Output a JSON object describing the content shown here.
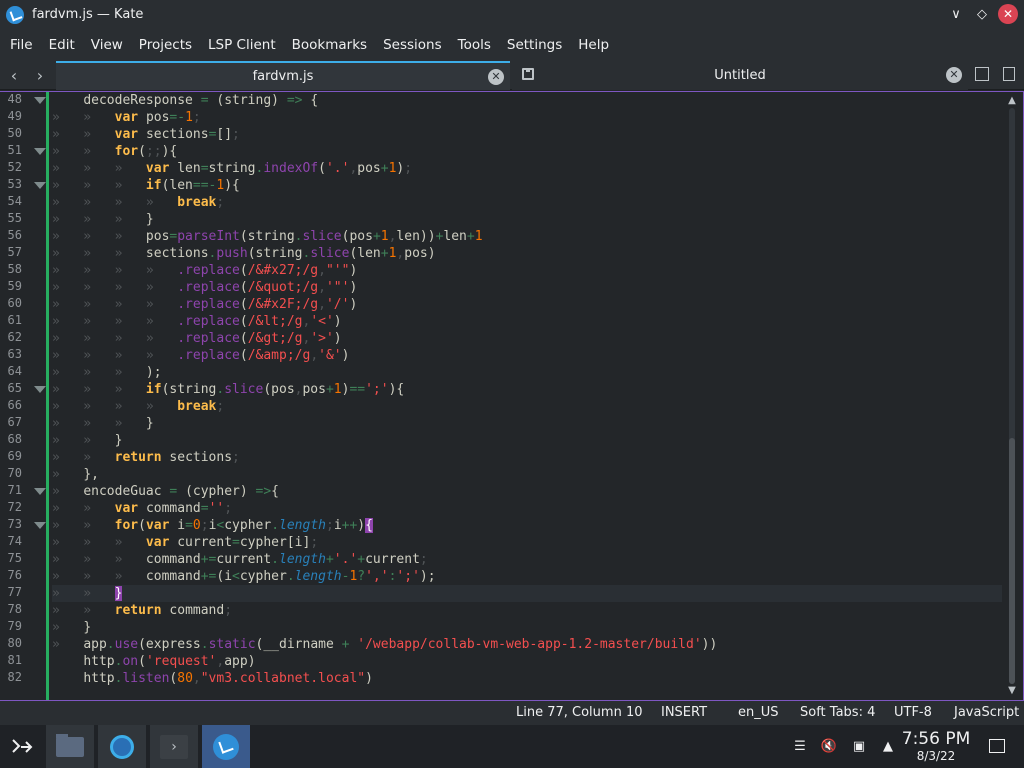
{
  "window": {
    "title": "fardvm.js — Kate"
  },
  "menu": [
    "File",
    "Edit",
    "View",
    "Projects",
    "LSP Client",
    "Bookmarks",
    "Sessions",
    "Tools",
    "Settings",
    "Help"
  ],
  "tabs": [
    {
      "label": "fardvm.js",
      "active": true
    },
    {
      "label": "Untitled",
      "active": false
    }
  ],
  "editor": {
    "current_line": 77,
    "lines": [
      {
        "n": 48,
        "fold": true,
        "tokens": [
          [
            "",
            ""
          ],
          [
            "    ",
            ""
          ],
          [
            "decodeResponse ",
            "punct"
          ],
          [
            "= ",
            "op"
          ],
          [
            "(string) ",
            "punct"
          ],
          [
            "=> ",
            "op"
          ],
          [
            "{",
            "punct"
          ]
        ]
      },
      {
        "n": 49,
        "fold": false,
        "tokens": [
          [
            "»   »   ",
            "ws"
          ],
          [
            "var ",
            "kw"
          ],
          [
            "pos",
            "punct"
          ],
          [
            "=-",
            "op"
          ],
          [
            "1",
            "num"
          ],
          [
            ";",
            "ws"
          ]
        ]
      },
      {
        "n": 50,
        "fold": false,
        "tokens": [
          [
            "»   »   ",
            "ws"
          ],
          [
            "var ",
            "kw"
          ],
          [
            "sections",
            "punct"
          ],
          [
            "=",
            "op"
          ],
          [
            "[]",
            "punct"
          ],
          [
            ";",
            "ws"
          ]
        ]
      },
      {
        "n": 51,
        "fold": true,
        "tokens": [
          [
            "»   »   ",
            "ws"
          ],
          [
            "for",
            "kw"
          ],
          [
            "(",
            "punct"
          ],
          [
            ";;",
            "ws"
          ],
          [
            "){",
            "punct"
          ]
        ]
      },
      {
        "n": 52,
        "fold": false,
        "tokens": [
          [
            "»   »   »   ",
            "ws"
          ],
          [
            "var ",
            "kw"
          ],
          [
            "len",
            "punct"
          ],
          [
            "=",
            "op"
          ],
          [
            "string",
            "punct"
          ],
          [
            ".",
            "op"
          ],
          [
            "indexOf",
            "fn"
          ],
          [
            "(",
            "punct"
          ],
          [
            "'.'",
            "str"
          ],
          [
            ",",
            "ws"
          ],
          [
            "pos",
            "punct"
          ],
          [
            "+",
            "op"
          ],
          [
            "1",
            "num"
          ],
          [
            ")",
            "punct"
          ],
          [
            ";",
            "ws"
          ]
        ]
      },
      {
        "n": 53,
        "fold": true,
        "tokens": [
          [
            "»   »   »   ",
            "ws"
          ],
          [
            "if",
            "kw"
          ],
          [
            "(len",
            "punct"
          ],
          [
            "==-",
            "op"
          ],
          [
            "1",
            "num"
          ],
          [
            "){",
            "punct"
          ]
        ]
      },
      {
        "n": 54,
        "fold": false,
        "tokens": [
          [
            "»   »   »   »   ",
            "ws"
          ],
          [
            "break",
            "kw"
          ],
          [
            ";",
            "ws"
          ]
        ]
      },
      {
        "n": 55,
        "fold": false,
        "tokens": [
          [
            "»   »   »   ",
            "ws"
          ],
          [
            "}",
            "punct"
          ]
        ]
      },
      {
        "n": 56,
        "fold": false,
        "tokens": [
          [
            "»   »   »   ",
            "ws"
          ],
          [
            "pos",
            "punct"
          ],
          [
            "=",
            "op"
          ],
          [
            "parseInt",
            "fn"
          ],
          [
            "(string",
            "punct"
          ],
          [
            ".",
            "op"
          ],
          [
            "slice",
            "fn"
          ],
          [
            "(pos",
            "punct"
          ],
          [
            "+",
            "op"
          ],
          [
            "1",
            "num"
          ],
          [
            ",",
            "ws"
          ],
          [
            "len))",
            "punct"
          ],
          [
            "+",
            "op"
          ],
          [
            "len",
            "punct"
          ],
          [
            "+",
            "op"
          ],
          [
            "1",
            "num"
          ]
        ]
      },
      {
        "n": 57,
        "fold": false,
        "tokens": [
          [
            "»   »   »   ",
            "ws"
          ],
          [
            "sections",
            "punct"
          ],
          [
            ".",
            "op"
          ],
          [
            "push",
            "fn"
          ],
          [
            "(string",
            "punct"
          ],
          [
            ".",
            "op"
          ],
          [
            "slice",
            "fn"
          ],
          [
            "(len",
            "punct"
          ],
          [
            "+",
            "op"
          ],
          [
            "1",
            "num"
          ],
          [
            ",",
            "ws"
          ],
          [
            "pos)",
            "punct"
          ]
        ]
      },
      {
        "n": 58,
        "fold": false,
        "tokens": [
          [
            "»   »   »   »   ",
            "ws"
          ],
          [
            ".replace",
            "fn"
          ],
          [
            "(",
            "punct"
          ],
          [
            "/&#x27;/g",
            "str"
          ],
          [
            ",",
            "ws"
          ],
          [
            "\"'\"",
            "str"
          ],
          [
            ")",
            "punct"
          ]
        ]
      },
      {
        "n": 59,
        "fold": false,
        "tokens": [
          [
            "»   »   »   »   ",
            "ws"
          ],
          [
            ".replace",
            "fn"
          ],
          [
            "(",
            "punct"
          ],
          [
            "/&quot;/g",
            "str"
          ],
          [
            ",",
            "ws"
          ],
          [
            "'\"'",
            "str"
          ],
          [
            ")",
            "punct"
          ]
        ]
      },
      {
        "n": 60,
        "fold": false,
        "tokens": [
          [
            "»   »   »   »   ",
            "ws"
          ],
          [
            ".replace",
            "fn"
          ],
          [
            "(",
            "punct"
          ],
          [
            "/&#x2F;/g",
            "str"
          ],
          [
            ",",
            "ws"
          ],
          [
            "'/'",
            "str"
          ],
          [
            ")",
            "punct"
          ]
        ]
      },
      {
        "n": 61,
        "fold": false,
        "tokens": [
          [
            "»   »   »   »   ",
            "ws"
          ],
          [
            ".replace",
            "fn"
          ],
          [
            "(",
            "punct"
          ],
          [
            "/&lt;/g",
            "str"
          ],
          [
            ",",
            "ws"
          ],
          [
            "'<'",
            "str"
          ],
          [
            ")",
            "punct"
          ]
        ]
      },
      {
        "n": 62,
        "fold": false,
        "tokens": [
          [
            "»   »   »   »   ",
            "ws"
          ],
          [
            ".replace",
            "fn"
          ],
          [
            "(",
            "punct"
          ],
          [
            "/&gt;/g",
            "str"
          ],
          [
            ",",
            "ws"
          ],
          [
            "'>'",
            "str"
          ],
          [
            ")",
            "punct"
          ]
        ]
      },
      {
        "n": 63,
        "fold": false,
        "tokens": [
          [
            "»   »   »   »   ",
            "ws"
          ],
          [
            ".replace",
            "fn"
          ],
          [
            "(",
            "punct"
          ],
          [
            "/&amp;/g",
            "str"
          ],
          [
            ",",
            "ws"
          ],
          [
            "'&'",
            "str"
          ],
          [
            ")",
            "punct"
          ]
        ]
      },
      {
        "n": 64,
        "fold": false,
        "tokens": [
          [
            "»   »   »   ",
            "ws"
          ],
          [
            ");",
            "punct"
          ]
        ]
      },
      {
        "n": 65,
        "fold": true,
        "tokens": [
          [
            "»   »   »   ",
            "ws"
          ],
          [
            "if",
            "kw"
          ],
          [
            "(string",
            "punct"
          ],
          [
            ".",
            "op"
          ],
          [
            "slice",
            "fn"
          ],
          [
            "(pos",
            "punct"
          ],
          [
            ",",
            "ws"
          ],
          [
            "pos",
            "punct"
          ],
          [
            "+",
            "op"
          ],
          [
            "1",
            "num"
          ],
          [
            ")",
            "punct"
          ],
          [
            "==",
            "op"
          ],
          [
            "';'",
            "str"
          ],
          [
            "){",
            "punct"
          ]
        ]
      },
      {
        "n": 66,
        "fold": false,
        "tokens": [
          [
            "»   »   »   »   ",
            "ws"
          ],
          [
            "break",
            "kw"
          ],
          [
            ";",
            "ws"
          ]
        ]
      },
      {
        "n": 67,
        "fold": false,
        "tokens": [
          [
            "»   »   »   ",
            "ws"
          ],
          [
            "}",
            "punct"
          ]
        ]
      },
      {
        "n": 68,
        "fold": false,
        "tokens": [
          [
            "»   »   ",
            "ws"
          ],
          [
            "}",
            "punct"
          ]
        ]
      },
      {
        "n": 69,
        "fold": false,
        "tokens": [
          [
            "»   »   ",
            "ws"
          ],
          [
            "return ",
            "kw"
          ],
          [
            "sections",
            "punct"
          ],
          [
            ";",
            "ws"
          ]
        ]
      },
      {
        "n": 70,
        "fold": false,
        "tokens": [
          [
            "»   ",
            "ws"
          ],
          [
            "},",
            "punct"
          ]
        ]
      },
      {
        "n": 71,
        "fold": true,
        "tokens": [
          [
            "»   ",
            "ws"
          ],
          [
            "encodeGuac ",
            "punct"
          ],
          [
            "= ",
            "op"
          ],
          [
            "(cypher) ",
            "punct"
          ],
          [
            "=>",
            "op"
          ],
          [
            "{",
            "punct"
          ]
        ]
      },
      {
        "n": 72,
        "fold": false,
        "tokens": [
          [
            "»   »   ",
            "ws"
          ],
          [
            "var ",
            "kw"
          ],
          [
            "command",
            "punct"
          ],
          [
            "=",
            "op"
          ],
          [
            "''",
            "str"
          ],
          [
            ";",
            "ws"
          ]
        ]
      },
      {
        "n": 73,
        "fold": true,
        "tokens": [
          [
            "»   »   ",
            "ws"
          ],
          [
            "for",
            "kw"
          ],
          [
            "(",
            "punct"
          ],
          [
            "var ",
            "kw"
          ],
          [
            "i",
            "punct"
          ],
          [
            "=",
            "op"
          ],
          [
            "0",
            "num"
          ],
          [
            ";",
            "ws"
          ],
          [
            "i",
            "punct"
          ],
          [
            "<",
            "op"
          ],
          [
            "cypher",
            "punct"
          ],
          [
            ".",
            "op"
          ],
          [
            "length",
            "prop"
          ],
          [
            ";",
            "ws"
          ],
          [
            "i",
            "punct"
          ],
          [
            "++",
            "op"
          ],
          [
            ")",
            "punct"
          ],
          [
            "{",
            "brkhl"
          ]
        ]
      },
      {
        "n": 74,
        "fold": false,
        "tokens": [
          [
            "»   »   »   ",
            "ws"
          ],
          [
            "var ",
            "kw"
          ],
          [
            "current",
            "punct"
          ],
          [
            "=",
            "op"
          ],
          [
            "cypher[i]",
            "punct"
          ],
          [
            ";",
            "ws"
          ]
        ]
      },
      {
        "n": 75,
        "fold": false,
        "tokens": [
          [
            "»   »   »   ",
            "ws"
          ],
          [
            "command",
            "punct"
          ],
          [
            "+=",
            "op"
          ],
          [
            "current",
            "punct"
          ],
          [
            ".",
            "op"
          ],
          [
            "length",
            "prop"
          ],
          [
            "+",
            "op"
          ],
          [
            "'.'",
            "str"
          ],
          [
            "+",
            "op"
          ],
          [
            "current",
            "punct"
          ],
          [
            ";",
            "ws"
          ]
        ]
      },
      {
        "n": 76,
        "fold": false,
        "tokens": [
          [
            "»   »   »   ",
            "ws"
          ],
          [
            "command",
            "punct"
          ],
          [
            "+=",
            "op"
          ],
          [
            "(i",
            "punct"
          ],
          [
            "<",
            "op"
          ],
          [
            "cypher",
            "punct"
          ],
          [
            ".",
            "op"
          ],
          [
            "length",
            "prop"
          ],
          [
            "-",
            "op"
          ],
          [
            "1",
            "num"
          ],
          [
            "?",
            "op"
          ],
          [
            "','",
            "str"
          ],
          [
            ":",
            "op"
          ],
          [
            "';'",
            "str"
          ],
          [
            ");",
            "punct"
          ]
        ]
      },
      {
        "n": 77,
        "fold": false,
        "tokens": [
          [
            "»   »   ",
            "ws"
          ],
          [
            "}",
            "brkhl"
          ]
        ]
      },
      {
        "n": 78,
        "fold": false,
        "tokens": [
          [
            "»   »   ",
            "ws"
          ],
          [
            "return ",
            "kw"
          ],
          [
            "command",
            "punct"
          ],
          [
            ";",
            "ws"
          ]
        ]
      },
      {
        "n": 79,
        "fold": false,
        "tokens": [
          [
            "»   ",
            "ws"
          ],
          [
            "}",
            "punct"
          ]
        ]
      },
      {
        "n": 80,
        "fold": false,
        "tokens": [
          [
            "»   ",
            "ws"
          ],
          [
            "app",
            "punct"
          ],
          [
            ".",
            "op"
          ],
          [
            "use",
            "fn"
          ],
          [
            "(express",
            "punct"
          ],
          [
            ".",
            "op"
          ],
          [
            "static",
            "fn"
          ],
          [
            "(__dirname ",
            "punct"
          ],
          [
            "+ ",
            "op"
          ],
          [
            "'/webapp/collab-vm-web-app-1.2-master/build'",
            "str"
          ],
          [
            "))",
            "punct"
          ]
        ]
      },
      {
        "n": 81,
        "fold": false,
        "tokens": [
          [
            "    ",
            ""
          ],
          [
            "http",
            "punct"
          ],
          [
            ".",
            "op"
          ],
          [
            "on",
            "fn"
          ],
          [
            "(",
            "punct"
          ],
          [
            "'request'",
            "str"
          ],
          [
            ",",
            "ws"
          ],
          [
            "app)",
            "punct"
          ]
        ]
      },
      {
        "n": 82,
        "fold": false,
        "tokens": [
          [
            "    ",
            ""
          ],
          [
            "http",
            "punct"
          ],
          [
            ".",
            "op"
          ],
          [
            "listen",
            "fn"
          ],
          [
            "(",
            "punct"
          ],
          [
            "80",
            "num"
          ],
          [
            ",",
            "ws"
          ],
          [
            "\"vm3.collabnet.local\"",
            "str"
          ],
          [
            ")",
            "punct"
          ]
        ]
      }
    ]
  },
  "status": {
    "position": "Line 77, Column 10",
    "mode": "INSERT",
    "language_dict": "en_US",
    "indent": "Soft Tabs: 4",
    "encoding": "UTF-8",
    "syntax": "JavaScript"
  },
  "taskbar": {
    "time": "7:56 PM",
    "date": "8/3/22"
  },
  "icons": {
    "app": "kate-icon",
    "files": "file-manager-icon",
    "browser": "chromium-icon",
    "terminal": "terminal-icon"
  }
}
